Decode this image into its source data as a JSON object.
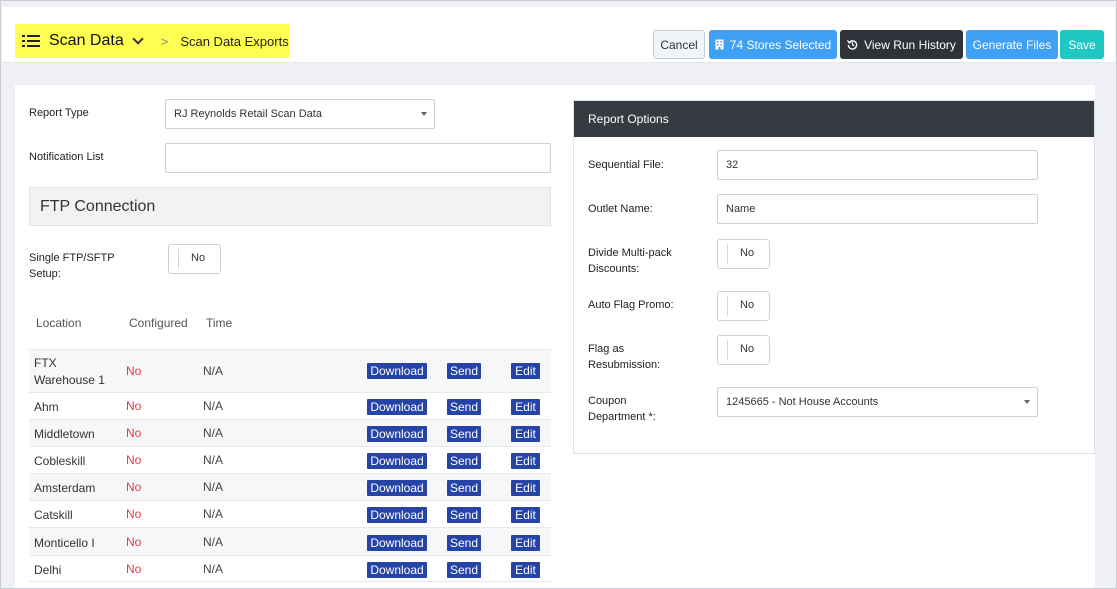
{
  "header": {
    "title": "Scan Data",
    "separator": ">",
    "subtitle": "Scan Data Exports",
    "buttons": {
      "cancel": "Cancel",
      "stores": "74 Stores Selected",
      "history": "View Run History",
      "generate": "Generate Files",
      "save": "Save"
    }
  },
  "form": {
    "report_type_label": "Report Type",
    "report_type_value": "RJ Reynolds Retail Scan Data",
    "notification_label": "Notification List",
    "notification_value": "",
    "ftp_section_title": "FTP Connection",
    "single_ftp_label_line1": "Single FTP/SFTP",
    "single_ftp_label_line2": "Setup:",
    "single_ftp_value": "No"
  },
  "table": {
    "headers": [
      "Location",
      "Configured",
      "Time"
    ],
    "action_labels": {
      "download": "Download",
      "send": "Send",
      "edit": "Edit"
    },
    "rows": [
      {
        "location_line1": "FTX",
        "location_line2": "Warehouse 1",
        "configured": "No",
        "time": "N/A"
      },
      {
        "location_line1": "Ahm",
        "location_line2": "",
        "configured": "No",
        "time": "N/A"
      },
      {
        "location_line1": "Middletown",
        "location_line2": "",
        "configured": "No",
        "time": "N/A"
      },
      {
        "location_line1": "Cobleskill",
        "location_line2": "",
        "configured": "No",
        "time": "N/A"
      },
      {
        "location_line1": "Amsterdam",
        "location_line2": "",
        "configured": "No",
        "time": "N/A"
      },
      {
        "location_line1": "Catskill",
        "location_line2": "",
        "configured": "No",
        "time": "N/A"
      },
      {
        "location_line1": "Monticello I",
        "location_line2": "",
        "configured": "No",
        "time": "N/A"
      },
      {
        "location_line1": "Delhi",
        "location_line2": "",
        "configured": "No",
        "time": "N/A"
      }
    ]
  },
  "report_options": {
    "title": "Report Options",
    "sequential_label": "Sequential File:",
    "sequential_value": "32",
    "outlet_label": "Outlet Name:",
    "outlet_value": "Name",
    "divide_label_line1": "Divide Multi-pack",
    "divide_label_line2": "Discounts:",
    "divide_value": "No",
    "auto_flag_label": "Auto Flag Promo:",
    "auto_flag_value": "No",
    "resub_label_line1": "Flag as",
    "resub_label_line2": "Resubmission:",
    "resub_value": "No",
    "coupon_label_line1": "Coupon",
    "coupon_label_line2": "Department *:",
    "coupon_value": "1245665 - Not House Accounts"
  },
  "colors": {
    "highlight": "#ffff52",
    "primary": "#3fa0f4",
    "dark": "#2e333a",
    "teal": "#1fc8c3",
    "action": "#2643a7",
    "no": "#e53946"
  }
}
